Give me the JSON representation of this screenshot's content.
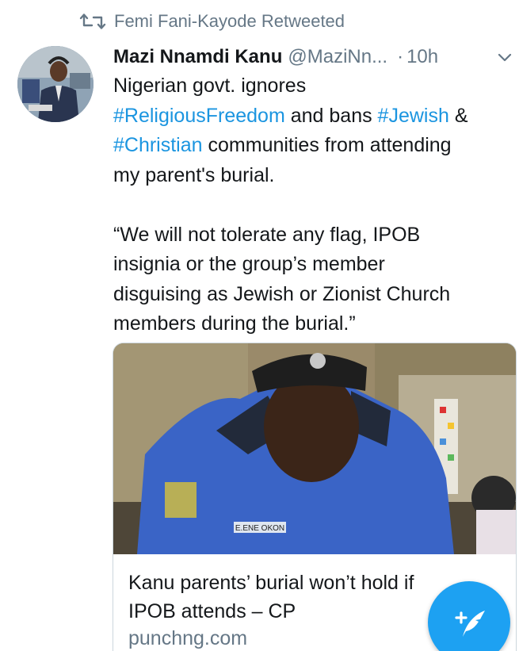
{
  "retweet": {
    "icon": "retweet-icon",
    "text": "Femi Fani-Kayode Retweeted"
  },
  "tweet": {
    "author_name": "Mazi Nnamdi Kanu",
    "author_handle": "@MaziNn...",
    "separator": "·",
    "time": "10h",
    "menu_icon": "chevron-down-icon",
    "paragraph1": {
      "line1": "Nigerian govt. ignores",
      "line2_tag1": "#ReligiousFreedom",
      "line2_mid": " and bans ",
      "line2_tag2": "#Jewish",
      "line2_end": " &",
      "line3_tag": "#Christian",
      "line3_rest": " communities from attending",
      "line4": "my parent's burial."
    },
    "paragraph2": [
      "“We will not tolerate any flag, IPOB",
      "insignia or the group’s member",
      "disguising as Jewish or Zionist Church",
      "members during the burial.”"
    ]
  },
  "card": {
    "title_line1": "Kanu parents’ burial won’t hold if",
    "title_line2": "IPOB attends – CP",
    "domain": "punchng.com",
    "image_badge_text": "E.ENE OKON"
  },
  "fab": {
    "icon": "compose-tweet-icon"
  },
  "colors": {
    "link": "#1b95e0",
    "secondary": "#657786",
    "fab": "#1da1f2"
  }
}
